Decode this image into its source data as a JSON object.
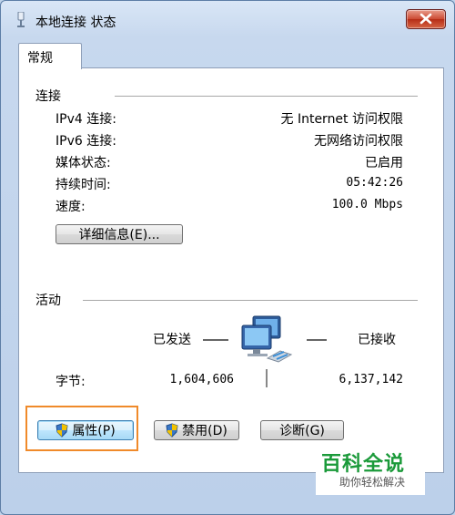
{
  "window": {
    "title": "本地连接 状态"
  },
  "tabs": [
    {
      "label": "常规"
    }
  ],
  "connection": {
    "section_title": "连接",
    "rows": [
      {
        "label": "IPv4 连接:",
        "value": "无 Internet 访问权限"
      },
      {
        "label": "IPv6 连接:",
        "value": "无网络访问权限"
      },
      {
        "label": "媒体状态:",
        "value": "已启用"
      },
      {
        "label": "持续时间:",
        "value": "05:42:26"
      },
      {
        "label": "速度:",
        "value": "100.0 Mbps"
      }
    ],
    "details_button": "详细信息(E)..."
  },
  "activity": {
    "section_title": "活动",
    "sent_label": "已发送",
    "received_label": "已接收",
    "bytes_label": "字节:",
    "bytes_sent": "1,604,606",
    "bytes_received": "6,137,142"
  },
  "buttons": {
    "properties": "属性(P)",
    "disable": "禁用(D)",
    "diagnose": "诊断(G)"
  },
  "watermark": {
    "title": "百科全说",
    "subtitle": "助你轻松解决"
  },
  "icons": [
    "network-adapter-icon",
    "close-icon",
    "shield-icon",
    "network-computers-icon"
  ],
  "colors": {
    "highlight": "#f08a2a",
    "watermark_green": "#1b9a3a"
  }
}
